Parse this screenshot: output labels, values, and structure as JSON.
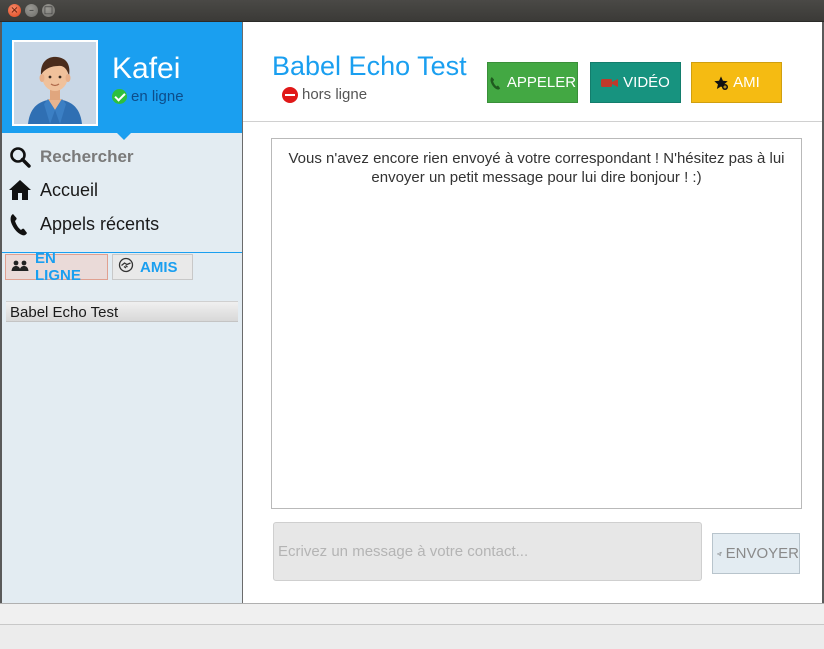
{
  "window": {
    "close_icon": "×",
    "minimize_icon": "–",
    "maximize_icon": "□"
  },
  "profile": {
    "name": "Kafei",
    "status": "en ligne",
    "status_icon": "check-circle-icon",
    "accent_color": "#1a9ff0"
  },
  "nav": {
    "search_label": "Rechercher",
    "home_label": "Accueil",
    "recent_label": "Appels récents"
  },
  "sidebar_tabs": {
    "online_label": "EN LIGNE",
    "friends_label": "AMIS"
  },
  "contacts": [
    {
      "name": "Babel Echo Test"
    }
  ],
  "conversation": {
    "contact_name": "Babel Echo Test",
    "contact_status": "hors ligne",
    "status_icon": "no-entry-icon",
    "call_label": "APPELER",
    "video_label": "VIDÉO",
    "friend_label": "AMI",
    "empty_message": "Vous n'avez encore rien envoyé à votre correspondant ! N'hésitez pas à lui envoyer un petit message pour lui dire bonjour ! :)",
    "input_placeholder": "Ecrivez un message à votre contact...",
    "send_label": "ENVOYER",
    "colors": {
      "call": "#43a843",
      "video": "#17937f",
      "friend": "#f5bb12"
    }
  }
}
